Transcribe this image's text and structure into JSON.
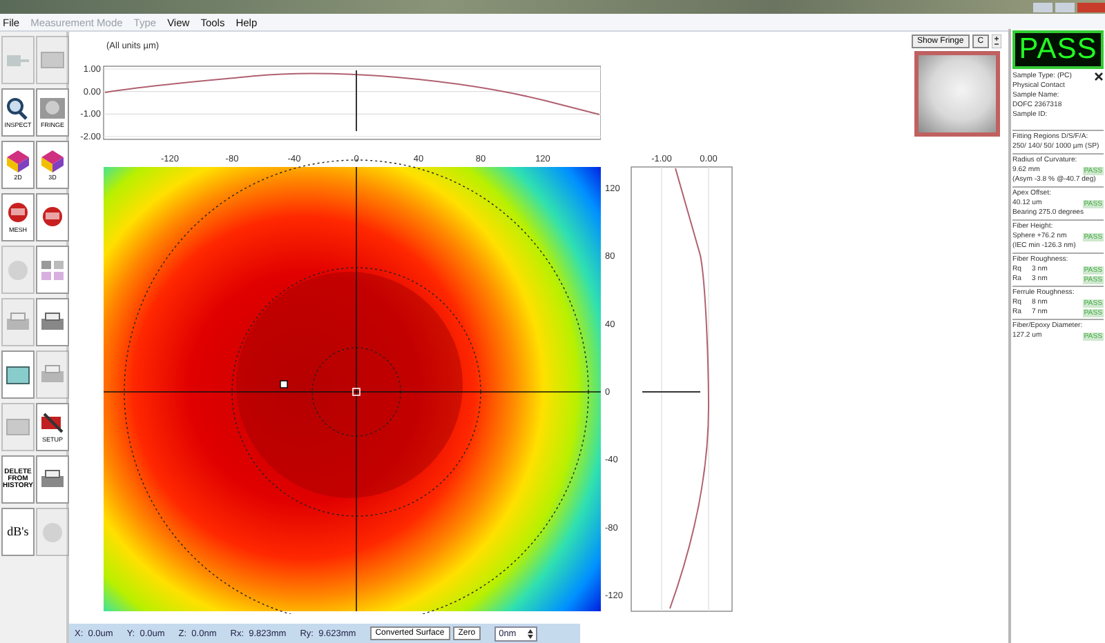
{
  "menu": [
    {
      "label": "File",
      "disabled": false
    },
    {
      "label": "Measurement Mode",
      "disabled": true
    },
    {
      "label": "Type",
      "disabled": true
    },
    {
      "label": "View",
      "disabled": false
    },
    {
      "label": "Tools",
      "disabled": false
    },
    {
      "label": "Help",
      "disabled": false
    }
  ],
  "toolbar": [
    {
      "kind": "plug",
      "disabled": true
    },
    {
      "kind": "panel",
      "disabled": true
    },
    {
      "kind": "magnifier",
      "label": "INSPECT",
      "disabled": false
    },
    {
      "kind": "pattern",
      "label": "FRINGE",
      "disabled": false
    },
    {
      "kind": "cube",
      "label": "2D",
      "disabled": false
    },
    {
      "kind": "cube",
      "label": "3D",
      "disabled": false
    },
    {
      "kind": "badge3d",
      "label": "MESH",
      "disabled": false
    },
    {
      "kind": "badge3d",
      "disabled": false
    },
    {
      "kind": "circle",
      "disabled": true
    },
    {
      "kind": "grid",
      "disabled": false
    },
    {
      "kind": "printer",
      "disabled": true
    },
    {
      "kind": "printer",
      "disabled": false
    },
    {
      "kind": "save",
      "disabled": false
    },
    {
      "kind": "printer",
      "disabled": true
    },
    {
      "kind": "panel",
      "disabled": true
    },
    {
      "kind": "tool",
      "label": "SETUP",
      "disabled": false
    },
    {
      "kind": "text",
      "label": "DELETE FROM HISTORY",
      "disabled": false
    },
    {
      "kind": "printer",
      "disabled": false
    },
    {
      "kind": "text",
      "label": "dB's",
      "disabled": false
    },
    {
      "kind": "circle",
      "disabled": true
    }
  ],
  "profile_top": {
    "units_note": "(All units µm)",
    "y_ticks": [
      "1.00",
      "0.00",
      "-1.00",
      "-2.00"
    ]
  },
  "fringe": {
    "show_button": "Show Fringe",
    "c_button": "C"
  },
  "heatmap": {
    "x_ticks": [
      "-120",
      "-80",
      "-40",
      "0",
      "40",
      "80",
      "120"
    ],
    "y_ticks": [
      "120",
      "80",
      "40",
      "0",
      "-40",
      "-80",
      "-120"
    ]
  },
  "profile_right": {
    "x_ticks": [
      "-1.00",
      "0.00"
    ]
  },
  "result": {
    "verdict": "PASS",
    "info": [
      {
        "kind": "plain",
        "text": "Sample Type: (PC)"
      },
      {
        "kind": "plain",
        "text": "Physical Contact"
      },
      {
        "kind": "plain",
        "text": "Sample Name:"
      },
      {
        "kind": "plain",
        "text": "DOFC 2367318"
      },
      {
        "kind": "plain",
        "text": "Sample ID:"
      }
    ],
    "sections": [
      {
        "title": "Fitting Regions D/S/F/A:",
        "rows": [
          {
            "text": "250/ 140/ 50/ 1000 µm  (SP)"
          }
        ]
      },
      {
        "title": "Radius of Curvature:",
        "rows": [
          {
            "text": "9.62 mm",
            "status": "PASS"
          },
          {
            "text": "(Asym -3.8 % @-40.7 deg)"
          }
        ]
      },
      {
        "title": "Apex Offset:",
        "rows": [
          {
            "text": "40.12 um",
            "status": "PASS"
          },
          {
            "text": "Bearing 275.0 degrees"
          }
        ]
      },
      {
        "title": "Fiber Height:",
        "rows": [
          {
            "text": "Sphere +76.2 nm",
            "status": "PASS"
          },
          {
            "text": "(IEC min -126.3 nm)"
          }
        ]
      },
      {
        "title": "Fiber Roughness:",
        "rows": [
          {
            "label": "Rq",
            "text": "3 nm",
            "status": "PASS"
          },
          {
            "label": "Ra",
            "text": "3 nm",
            "status": "PASS"
          }
        ]
      },
      {
        "title": "Ferrule Roughness:",
        "rows": [
          {
            "label": "Rq",
            "text": "8 nm",
            "status": "PASS"
          },
          {
            "label": "Ra",
            "text": "7 nm",
            "status": "PASS"
          }
        ]
      },
      {
        "title": "Fiber/Epoxy Diameter:",
        "rows": [
          {
            "text": "127.2 um",
            "status": "PASS"
          }
        ]
      }
    ]
  },
  "status_bar": {
    "readouts": [
      "X:  0.0um",
      "Y:  0.0um",
      "Z:  0.0nm",
      "Rx:  9.823mm",
      "Ry:  9.623mm"
    ],
    "surface_button": "Converted Surface",
    "zero_button": "Zero",
    "offset_value": "0nm"
  }
}
